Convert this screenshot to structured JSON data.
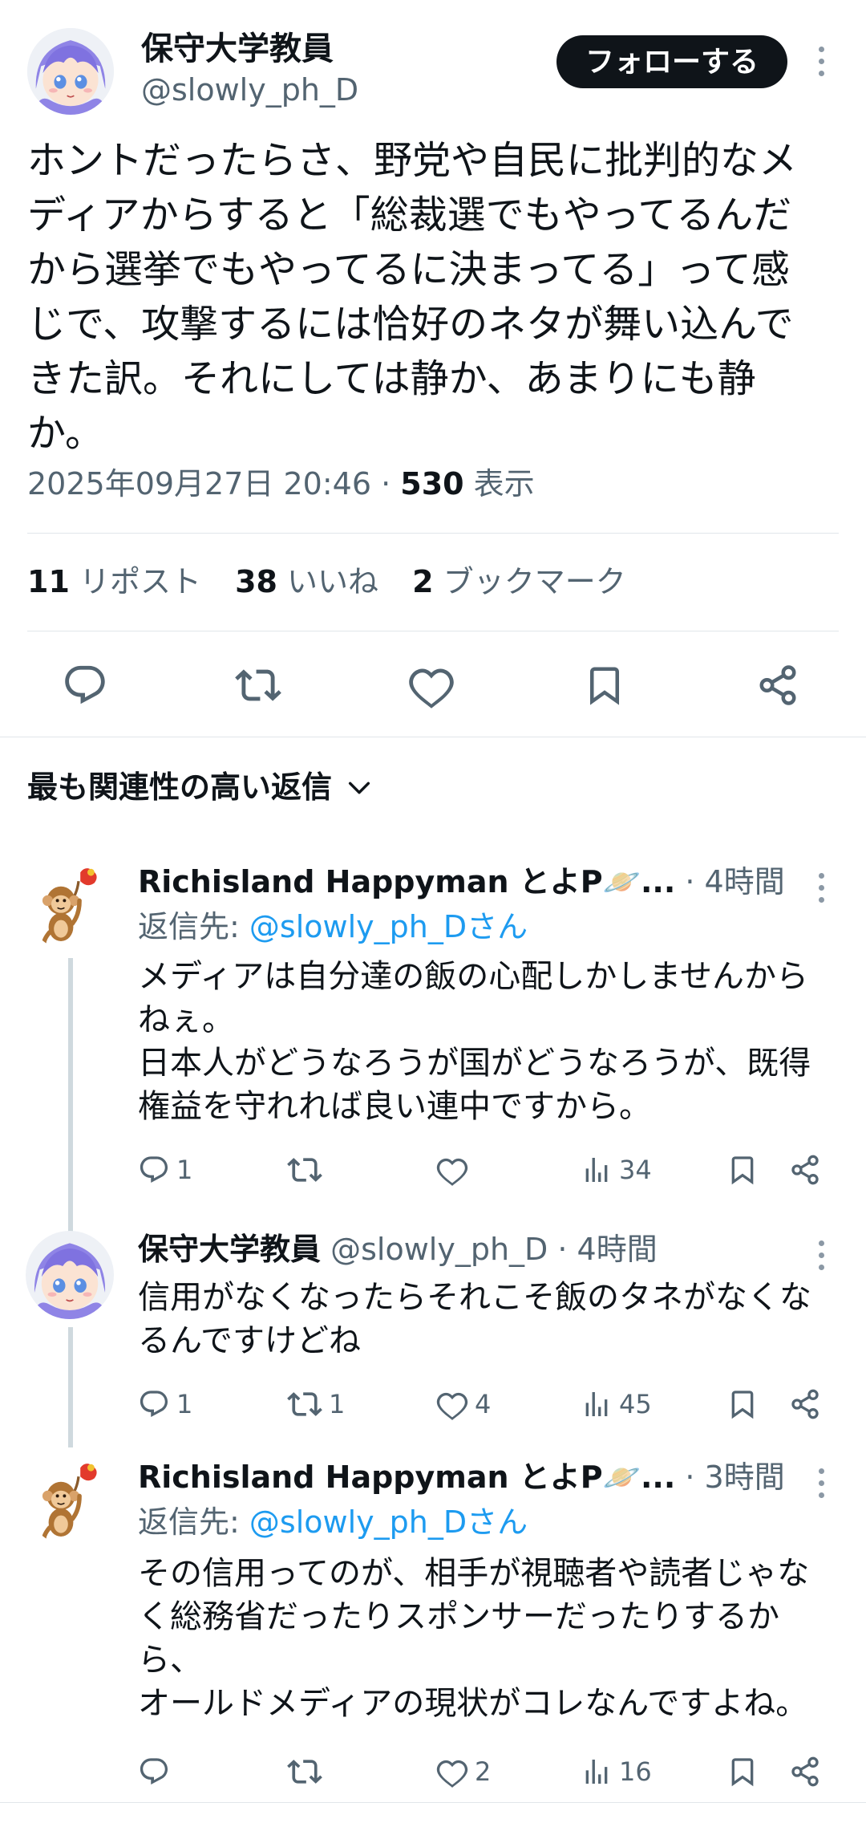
{
  "tweet": {
    "author_name": "保守大学教員",
    "author_handle": "@slowly_ph_D",
    "follow_label": "フォローする",
    "text": "ホントだったらさ、野党や自民に批判的なメ\nディアからすると「総裁選でもやってるんだ\nから選挙でもやってるに決まってる」って感\nじで、攻撃するには恰好のネタが舞い込んで\nきた訳。それにしては静か、あまりにも静\nか。",
    "timestamp": "2025年09月27日 20:46",
    "separator": " · ",
    "views_count": "530",
    "views_label": " 表示",
    "reposts_count": "11",
    "reposts_label": " リポスト",
    "likes_count": "38",
    "likes_label": " いいね",
    "bookmarks_count": "2",
    "bookmarks_label": " ブックマーク"
  },
  "sort_label": "最も関連性の高い返信",
  "replies": [
    {
      "author_name": "Richisland Happyman とよP🪐...",
      "time": " · 4時間",
      "reply_to_prefix": "返信先: ",
      "reply_to_mention": "@slowly_ph_Dさん",
      "text": "メディアは自分達の飯の心配しかしませんから\nねぇ。\n日本人がどうなろうが国がどうなろうが、既得\n権益を守れれば良い連中ですから。",
      "replies": "1",
      "reposts": "",
      "likes": "",
      "views": "34"
    },
    {
      "author_name": "保守大学教員",
      "handle_time": " @slowly_ph_D · 4時間",
      "text": "信用がなくなったらそれこそ飯のタネがなくな\nるんですけどね",
      "replies": "1",
      "reposts": "1",
      "likes": "4",
      "views": "45"
    },
    {
      "author_name": "Richisland Happyman とよP🪐...",
      "time": " · 3時間",
      "reply_to_prefix": "返信先: ",
      "reply_to_mention": "@slowly_ph_Dさん",
      "text": "その信用ってのが、相手が視聴者や読者じゃな\nく総務省だったりスポンサーだったりするか\nら、\nオールドメディアの現状がコレなんですよね。",
      "replies": "",
      "reposts": "",
      "likes": "2",
      "views": "16"
    }
  ],
  "icons": {
    "reply": "reply-icon",
    "repost": "repost-icon",
    "like": "heart-icon",
    "bookmark": "bookmark-icon",
    "share": "share-icon",
    "views": "views-icon",
    "more": "more-icon",
    "chevron": "chevron-down-icon"
  },
  "colors": {
    "text": "#0f1419",
    "secondary": "#536471",
    "link": "#1d9bf0",
    "button": "#0f1419"
  }
}
